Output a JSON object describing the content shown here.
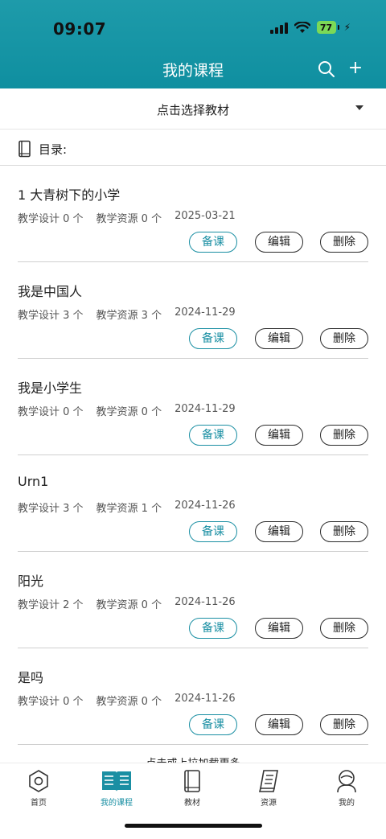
{
  "status_bar": {
    "time": "09:07",
    "battery": "77"
  },
  "header": {
    "title": "我的课程"
  },
  "picker": {
    "label": "点击选择教材"
  },
  "toc": {
    "label": "目录:"
  },
  "courses": [
    {
      "name": "1 大青树下的小学",
      "design": "教学设计 0 个",
      "resource": "教学资源 0 个",
      "date": "2025-03-21"
    },
    {
      "name": "我是中国人",
      "design": "教学设计 3 个",
      "resource": "教学资源 3 个",
      "date": "2024-11-29"
    },
    {
      "name": "我是小学生",
      "design": "教学设计 0 个",
      "resource": "教学资源 0 个",
      "date": "2024-11-29"
    },
    {
      "name": "Urn1",
      "design": "教学设计 3 个",
      "resource": "教学资源 1 个",
      "date": "2024-11-26"
    },
    {
      "name": "阳光",
      "design": "教学设计 2 个",
      "resource": "教学资源 0 个",
      "date": "2024-11-26"
    },
    {
      "name": "是吗",
      "design": "教学设计 0 个",
      "resource": "教学资源 0 个",
      "date": "2024-11-26"
    }
  ],
  "buttons": {
    "prepare": "备课",
    "edit": "编辑",
    "delete": "删除"
  },
  "load_more": "点击或上拉加载更多",
  "tabs": [
    {
      "label": "首页",
      "icon": "home-hexagon-icon"
    },
    {
      "label": "我的课程",
      "icon": "open-book-icon"
    },
    {
      "label": "教材",
      "icon": "textbook-icon"
    },
    {
      "label": "资源",
      "icon": "resource-book-icon"
    },
    {
      "label": "我的",
      "icon": "user-icon"
    }
  ],
  "colors": {
    "header": "#1498a8",
    "accent": "#1a8fa3"
  }
}
